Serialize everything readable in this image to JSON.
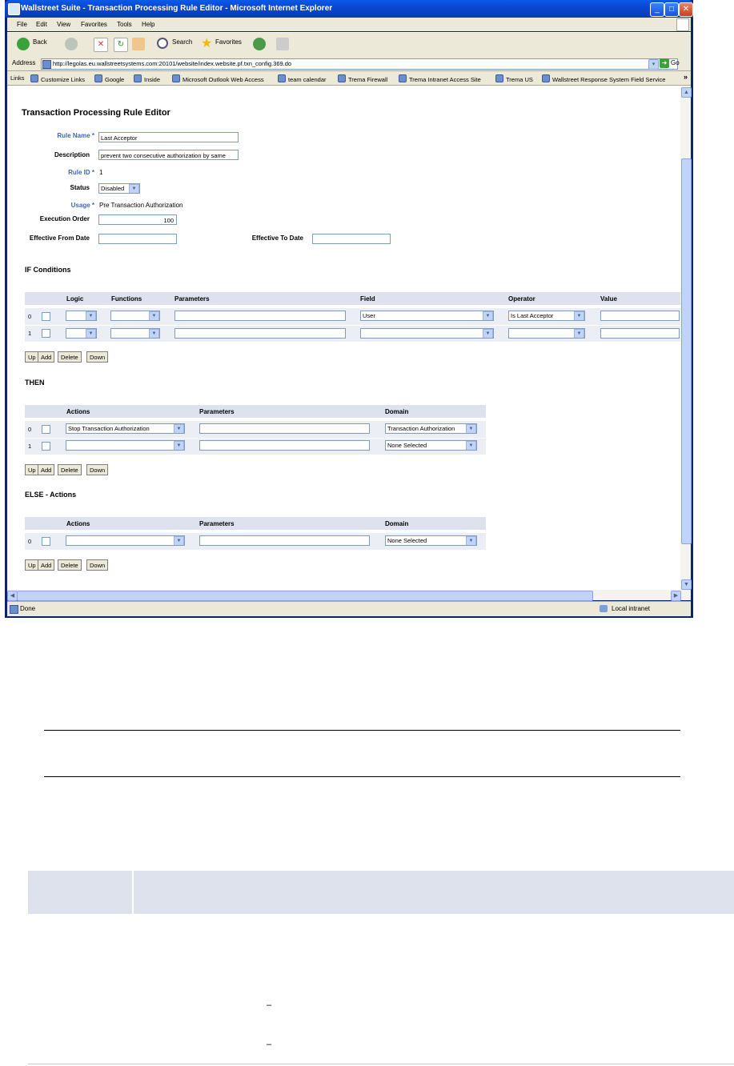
{
  "window": {
    "title": "Wallstreet Suite - Transaction Processing Rule Editor - Microsoft Internet Explorer",
    "minimize": "_",
    "maximize": "□",
    "close": "✕"
  },
  "menubar": {
    "items": [
      "File",
      "Edit",
      "View",
      "Favorites",
      "Tools",
      "Help"
    ]
  },
  "toolbar": {
    "back_label": "Back",
    "search_label": "Search",
    "favorites_label": "Favorites"
  },
  "address": {
    "label": "Address",
    "url": "http://legolas.eu.wallstreetsystems.com:20101/website/index.website.pf.txn_config.369.do",
    "go_label": "Go"
  },
  "links": {
    "label": "Links",
    "items": [
      "Customize Links",
      "Google",
      "Inside",
      "Microsoft Outlook Web Access",
      "team calendar",
      "Trema Firewall",
      "Trema Intranet Access Site",
      "Trema US",
      "Wallstreet Response System Field Service"
    ],
    "more": "»"
  },
  "page": {
    "title": "Transaction Processing Rule Editor",
    "rule_name_label": "Rule Name *",
    "rule_name_value": "Last Acceptor",
    "description_label": "Description",
    "description_value": "prevent two consecutive authorization by same",
    "rule_id_label": "Rule ID *",
    "rule_id_value": "1",
    "status_label": "Status",
    "status_value": "Disabled",
    "usage_label": "Usage *",
    "usage_value": "Pre Transaction Authorization",
    "execution_order_label": "Execution Order",
    "execution_order_value": "100",
    "effective_from_label": "Effective From Date",
    "effective_to_label": "Effective To Date"
  },
  "if_conditions": {
    "title": "IF Conditions",
    "headers": [
      "Logic",
      "Functions",
      "Parameters",
      "Field",
      "Operator",
      "Value"
    ],
    "rows": [
      {
        "index": "0",
        "logic": "",
        "functions": "",
        "parameters": "",
        "field": "User",
        "operator": "Is Last Acceptor",
        "value": ""
      },
      {
        "index": "1",
        "logic": "",
        "functions": "",
        "parameters": "",
        "field": "",
        "operator": "",
        "value": ""
      }
    ]
  },
  "then": {
    "title": "THEN",
    "headers": [
      "Actions",
      "Parameters",
      "Domain"
    ],
    "rows": [
      {
        "index": "0",
        "action": "Stop Transaction Authorization",
        "parameters": "",
        "domain": "Transaction Authorization"
      },
      {
        "index": "1",
        "action": "",
        "parameters": "",
        "domain": "None Selected"
      }
    ]
  },
  "else": {
    "title": "ELSE - Actions",
    "headers": [
      "Actions",
      "Parameters",
      "Domain"
    ],
    "rows": [
      {
        "index": "0",
        "action": "",
        "parameters": "",
        "domain": "None Selected"
      }
    ]
  },
  "buttons": {
    "up": "Up",
    "add": "Add",
    "delete": "Delete",
    "down": "Down"
  },
  "statusbar": {
    "text": "Done",
    "zone": "Local intranet"
  },
  "doc": {
    "marker1": "–",
    "marker2": "–"
  }
}
